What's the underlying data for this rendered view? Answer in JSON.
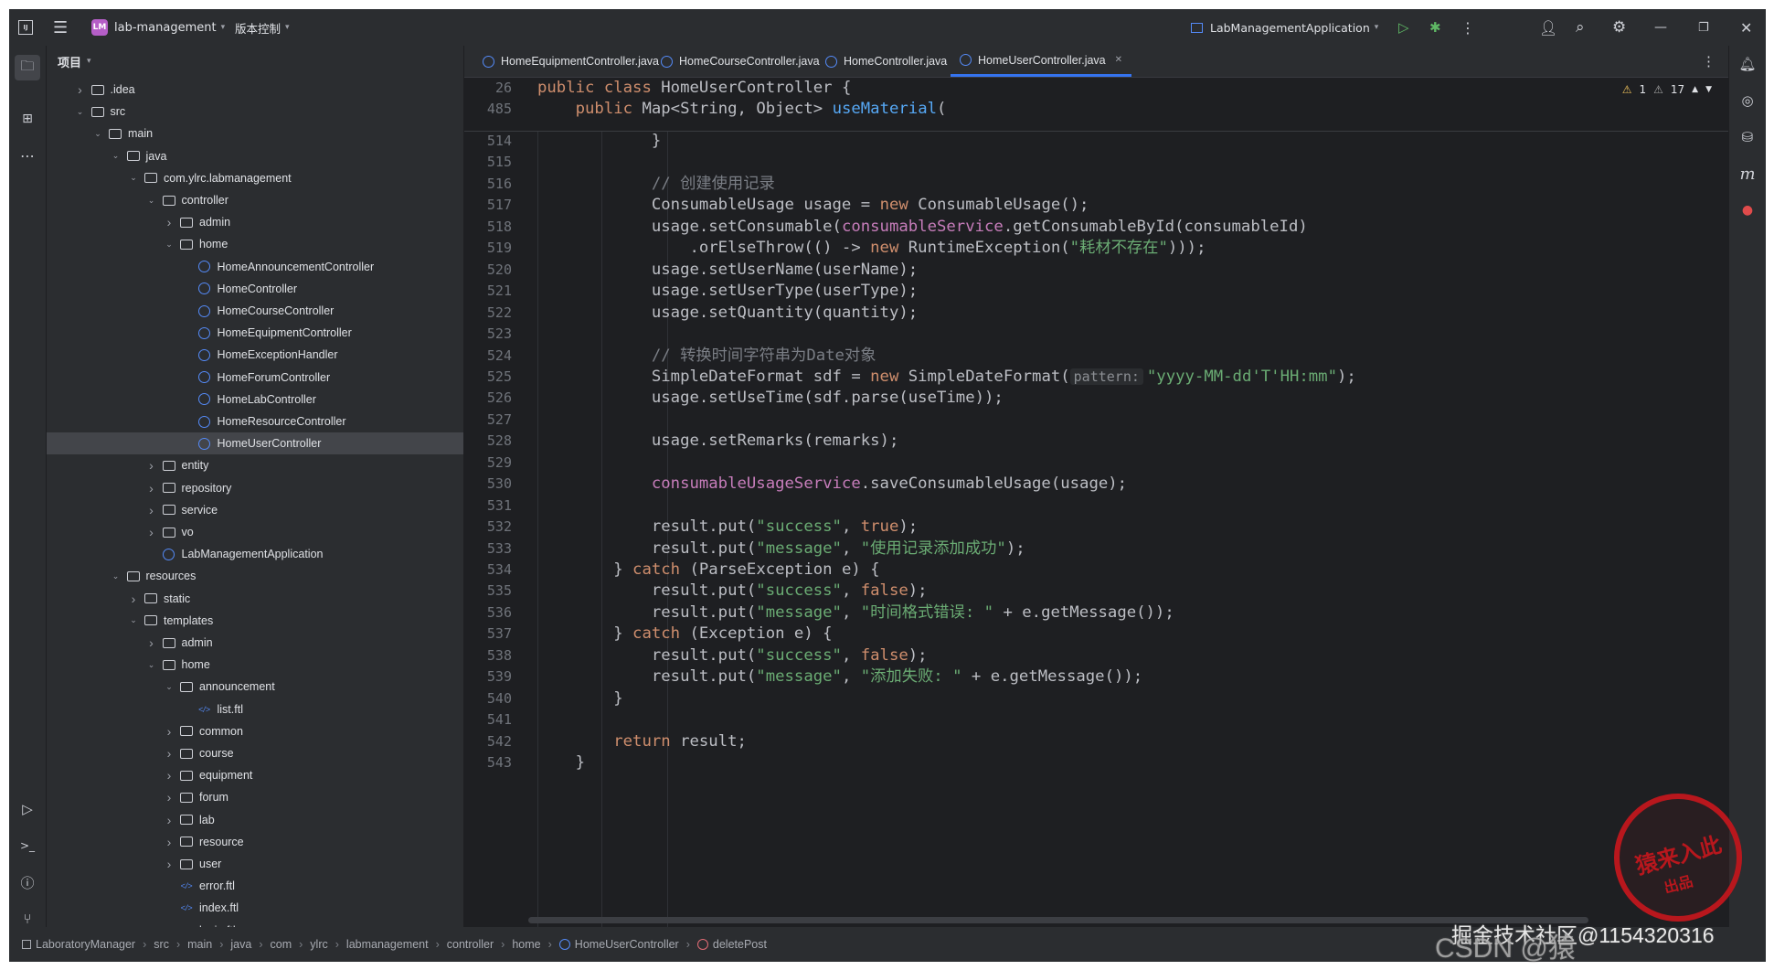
{
  "titlebar": {
    "project_badge": "LM",
    "project_name": "lab-management",
    "vcs_label": "版本控制",
    "run_config": "LabManagementApplication"
  },
  "project_panel": {
    "title": "项目",
    "tree": [
      {
        "label": ".idea",
        "depth": 1,
        "type": "folder",
        "state": "collapsed"
      },
      {
        "label": "src",
        "depth": 1,
        "type": "folder",
        "state": "expanded"
      },
      {
        "label": "main",
        "depth": 2,
        "type": "folder",
        "state": "expanded"
      },
      {
        "label": "java",
        "depth": 3,
        "type": "folder",
        "state": "expanded"
      },
      {
        "label": "com.ylrc.labmanagement",
        "depth": 4,
        "type": "package",
        "state": "expanded"
      },
      {
        "label": "controller",
        "depth": 5,
        "type": "package",
        "state": "expanded"
      },
      {
        "label": "admin",
        "depth": 6,
        "type": "package",
        "state": "collapsed"
      },
      {
        "label": "home",
        "depth": 6,
        "type": "package",
        "state": "expanded"
      },
      {
        "label": "HomeAnnouncementController",
        "depth": 7,
        "type": "class",
        "state": "leaf"
      },
      {
        "label": "HomeController",
        "depth": 7,
        "type": "class",
        "state": "leaf"
      },
      {
        "label": "HomeCourseController",
        "depth": 7,
        "type": "class",
        "state": "leaf"
      },
      {
        "label": "HomeEquipmentController",
        "depth": 7,
        "type": "class",
        "state": "leaf"
      },
      {
        "label": "HomeExceptionHandler",
        "depth": 7,
        "type": "class",
        "state": "leaf"
      },
      {
        "label": "HomeForumController",
        "depth": 7,
        "type": "class",
        "state": "leaf"
      },
      {
        "label": "HomeLabController",
        "depth": 7,
        "type": "class",
        "state": "leaf"
      },
      {
        "label": "HomeResourceController",
        "depth": 7,
        "type": "class",
        "state": "leaf"
      },
      {
        "label": "HomeUserController",
        "depth": 7,
        "type": "class",
        "state": "leaf",
        "selected": true
      },
      {
        "label": "entity",
        "depth": 5,
        "type": "package",
        "state": "collapsed"
      },
      {
        "label": "repository",
        "depth": 5,
        "type": "package",
        "state": "collapsed"
      },
      {
        "label": "service",
        "depth": 5,
        "type": "package",
        "state": "collapsed"
      },
      {
        "label": "vo",
        "depth": 5,
        "type": "package",
        "state": "collapsed"
      },
      {
        "label": "LabManagementApplication",
        "depth": 5,
        "type": "app",
        "state": "leaf"
      },
      {
        "label": "resources",
        "depth": 3,
        "type": "folder",
        "state": "expanded"
      },
      {
        "label": "static",
        "depth": 4,
        "type": "folder",
        "state": "collapsed"
      },
      {
        "label": "templates",
        "depth": 4,
        "type": "folder",
        "state": "expanded"
      },
      {
        "label": "admin",
        "depth": 5,
        "type": "folder",
        "state": "collapsed"
      },
      {
        "label": "home",
        "depth": 5,
        "type": "folder",
        "state": "expanded"
      },
      {
        "label": "announcement",
        "depth": 6,
        "type": "folder",
        "state": "expanded"
      },
      {
        "label": "list.ftl",
        "depth": 7,
        "type": "ftl",
        "state": "leaf"
      },
      {
        "label": "common",
        "depth": 6,
        "type": "folder",
        "state": "collapsed"
      },
      {
        "label": "course",
        "depth": 6,
        "type": "folder",
        "state": "collapsed"
      },
      {
        "label": "equipment",
        "depth": 6,
        "type": "folder",
        "state": "collapsed"
      },
      {
        "label": "forum",
        "depth": 6,
        "type": "folder",
        "state": "collapsed"
      },
      {
        "label": "lab",
        "depth": 6,
        "type": "folder",
        "state": "collapsed"
      },
      {
        "label": "resource",
        "depth": 6,
        "type": "folder",
        "state": "collapsed"
      },
      {
        "label": "user",
        "depth": 6,
        "type": "folder",
        "state": "collapsed"
      },
      {
        "label": "error.ftl",
        "depth": 6,
        "type": "ftl",
        "state": "leaf"
      },
      {
        "label": "index.ftl",
        "depth": 6,
        "type": "ftl",
        "state": "leaf"
      },
      {
        "label": "login.ftl",
        "depth": 6,
        "type": "ftl",
        "state": "leaf"
      }
    ]
  },
  "tabs": [
    {
      "label": "HomeEquipmentController.java",
      "active": false
    },
    {
      "label": "HomeCourseController.java",
      "active": false
    },
    {
      "label": "HomeController.java",
      "active": false
    },
    {
      "label": "HomeUserController.java",
      "active": true
    }
  ],
  "inspections": {
    "warnings": "1",
    "weak_warnings": "17"
  },
  "editor": {
    "sticky_lines": [
      {
        "n": "26",
        "tokens": [
          [
            "kw",
            "public class "
          ],
          [
            "",
            "HomeUserController {"
          ]
        ]
      },
      {
        "n": "485",
        "tokens": [
          [
            "",
            "    "
          ],
          [
            "kw",
            "public "
          ],
          [
            "",
            "Map<String, Object> "
          ],
          [
            "fn",
            "useMaterial"
          ],
          [
            "",
            "("
          ]
        ]
      }
    ],
    "lines": [
      {
        "n": "514",
        "tokens": [
          [
            "",
            "            }"
          ]
        ]
      },
      {
        "n": "515",
        "tokens": [
          [
            "",
            ""
          ]
        ]
      },
      {
        "n": "516",
        "tokens": [
          [
            "cm",
            "            // 创建使用记录"
          ]
        ]
      },
      {
        "n": "517",
        "tokens": [
          [
            "",
            "            ConsumableUsage usage = "
          ],
          [
            "kw",
            "new "
          ],
          [
            "",
            "ConsumableUsage();"
          ]
        ]
      },
      {
        "n": "518",
        "tokens": [
          [
            "",
            "            usage.setConsumable("
          ],
          [
            "fld",
            "consumableService"
          ],
          [
            "",
            ".getConsumableById(consumableId)"
          ]
        ]
      },
      {
        "n": "519",
        "tokens": [
          [
            "",
            "                .orElseThrow(() -> "
          ],
          [
            "kw",
            "new "
          ],
          [
            "",
            "RuntimeException("
          ],
          [
            "str",
            "\"耗材不存在\""
          ],
          [
            "",
            ")));"
          ]
        ]
      },
      {
        "n": "520",
        "tokens": [
          [
            "",
            "            usage.setUserName(userName);"
          ]
        ]
      },
      {
        "n": "521",
        "tokens": [
          [
            "",
            "            usage.setUserType(userType);"
          ]
        ]
      },
      {
        "n": "522",
        "tokens": [
          [
            "",
            "            usage.setQuantity(quantity);"
          ]
        ]
      },
      {
        "n": "523",
        "tokens": [
          [
            "",
            ""
          ]
        ]
      },
      {
        "n": "524",
        "tokens": [
          [
            "cm",
            "            // 转换时间字符串为Date对象"
          ]
        ]
      },
      {
        "n": "525",
        "tokens": [
          [
            "",
            "            SimpleDateFormat sdf = "
          ],
          [
            "kw",
            "new "
          ],
          [
            "",
            "SimpleDateFormat("
          ],
          [
            "hint",
            "pattern:"
          ],
          [
            "str",
            "\"yyyy-MM-dd'T'HH:mm\""
          ],
          [
            "",
            ");"
          ]
        ]
      },
      {
        "n": "526",
        "tokens": [
          [
            "",
            "            usage.setUseTime(sdf.parse(useTime));"
          ]
        ]
      },
      {
        "n": "527",
        "tokens": [
          [
            "",
            ""
          ]
        ]
      },
      {
        "n": "528",
        "tokens": [
          [
            "",
            "            usage.setRemarks(remarks);"
          ]
        ]
      },
      {
        "n": "529",
        "tokens": [
          [
            "",
            ""
          ]
        ]
      },
      {
        "n": "530",
        "tokens": [
          [
            "fld",
            "            consumableUsageService"
          ],
          [
            "",
            ".saveConsumableUsage(usage);"
          ]
        ]
      },
      {
        "n": "531",
        "tokens": [
          [
            "",
            ""
          ]
        ]
      },
      {
        "n": "532",
        "tokens": [
          [
            "",
            "            result.put("
          ],
          [
            "str",
            "\"success\""
          ],
          [
            "",
            ", "
          ],
          [
            "kw",
            "true"
          ],
          [
            "",
            ");"
          ]
        ]
      },
      {
        "n": "533",
        "tokens": [
          [
            "",
            "            result.put("
          ],
          [
            "str",
            "\"message\""
          ],
          [
            "",
            ", "
          ],
          [
            "str",
            "\"使用记录添加成功\""
          ],
          [
            "",
            ");"
          ]
        ]
      },
      {
        "n": "534",
        "tokens": [
          [
            "",
            "        } "
          ],
          [
            "kw",
            "catch "
          ],
          [
            "",
            "(ParseException e) {"
          ]
        ]
      },
      {
        "n": "535",
        "tokens": [
          [
            "",
            "            result.put("
          ],
          [
            "str",
            "\"success\""
          ],
          [
            "",
            ", "
          ],
          [
            "kw",
            "false"
          ],
          [
            "",
            ");"
          ]
        ]
      },
      {
        "n": "536",
        "tokens": [
          [
            "",
            "            result.put("
          ],
          [
            "str",
            "\"message\""
          ],
          [
            "",
            ", "
          ],
          [
            "str",
            "\"时间格式错误: \""
          ],
          [
            "",
            " + e.getMessage());"
          ]
        ]
      },
      {
        "n": "537",
        "tokens": [
          [
            "",
            "        } "
          ],
          [
            "kw",
            "catch "
          ],
          [
            "",
            "(Exception e) {"
          ]
        ]
      },
      {
        "n": "538",
        "tokens": [
          [
            "",
            "            result.put("
          ],
          [
            "str",
            "\"success\""
          ],
          [
            "",
            ", "
          ],
          [
            "kw",
            "false"
          ],
          [
            "",
            ");"
          ]
        ]
      },
      {
        "n": "539",
        "tokens": [
          [
            "",
            "            result.put("
          ],
          [
            "str",
            "\"message\""
          ],
          [
            "",
            ", "
          ],
          [
            "str",
            "\"添加失败: \""
          ],
          [
            "",
            " + e.getMessage());"
          ]
        ]
      },
      {
        "n": "540",
        "tokens": [
          [
            "",
            "        }"
          ]
        ]
      },
      {
        "n": "541",
        "tokens": [
          [
            "",
            ""
          ]
        ]
      },
      {
        "n": "542",
        "tokens": [
          [
            "",
            "        "
          ],
          [
            "kw",
            "return "
          ],
          [
            "",
            "result;"
          ]
        ]
      },
      {
        "n": "543",
        "tokens": [
          [
            "",
            "    }"
          ]
        ]
      }
    ]
  },
  "breadcrumbs": [
    "LaboratoryManager",
    "src",
    "main",
    "java",
    "com",
    "ylrc",
    "labmanagement",
    "controller",
    "home",
    "HomeUserController",
    "deletePost"
  ],
  "watermark": {
    "text": "掘金技术社区@1154320316",
    "csdn": "CSDN @猿",
    "seal_text": "猿来入此",
    "seal_sub": "出品"
  },
  "colors": {
    "accent": "#3574f0",
    "keyword": "#cf8e6d",
    "string": "#6aab73",
    "field": "#c77dbb",
    "method": "#56a8f5",
    "comment": "#7a7e85"
  }
}
